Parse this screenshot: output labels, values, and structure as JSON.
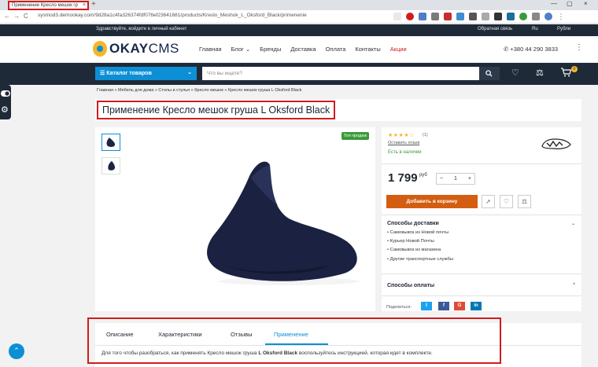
{
  "browser": {
    "tab_title": "Применение Кресло мешок гр",
    "tab_close": "×",
    "new_tab": "+",
    "window_controls": [
      "—",
      "▢",
      "×"
    ],
    "back": "←",
    "forward": "→",
    "reload": "C",
    "url": "sysmod3.demookay.com/9d28a1c4fa326374fdf076ef23641681/products/Kreslo_Meshok_L_Oksford_Black/primenenie"
  },
  "topstrip": {
    "greeting": "Здравствуйте, войдите в личный кабинет",
    "callback": "Обратная связь",
    "language": "Ru",
    "currency": "Рубли"
  },
  "header": {
    "logo_okay": "OKAY",
    "logo_cms": "CMS",
    "nav": [
      "Главная",
      "Блог",
      "Бренды",
      "Доставка",
      "Оплата",
      "Контакты"
    ],
    "nav_promo": "Акции",
    "blog_chevron": "⌄",
    "phone": "+380 44 290 3833",
    "kebab": "⋮"
  },
  "catalog": {
    "button": "Каталог товаров",
    "chevron": "⌄",
    "search_placeholder": "Что вы ищете?",
    "cart_count": "0"
  },
  "breadcrumb": "Главная » Мебель для дома » Столы и стулья » Кресло мешок » Кресло мешок груша L Oksford Black",
  "product": {
    "title": "Применение Кресло мешок груша L Oksford Black",
    "badge": "Топ продаж",
    "stars": "★★★★☆",
    "rating_count": "(1)",
    "review_link": "Оставить отзыв",
    "stock": "Есть в наличии",
    "price": "1 799",
    "currency": "руб",
    "qty_minus": "−",
    "qty_value": "1",
    "qty_plus": "+",
    "add_to_cart": "Добавить в корзину",
    "delivery_title": "Способы доставки",
    "delivery_chevron": "⌄",
    "delivery_items": [
      "Самовывоз из Новой почты",
      "Курьер Новой Почты",
      "Самовывоз из магазина",
      "Другие транспортные службы"
    ],
    "payment_title": "Способы оплаты",
    "payment_chevron": "^",
    "share_label": "Поделиться:",
    "share_buttons": [
      "t",
      "f",
      "G",
      "in"
    ]
  },
  "tabs": {
    "items": [
      "Описание",
      "Характеристики",
      "Отзывы",
      "Применение"
    ],
    "description_prefix": "Для того чтобы разобраться, как применять Кресло мешок груша ",
    "description_bold": "L Oksford Black",
    "description_suffix": " воспользуйтесь инструкцией, которая идет в комплекте."
  },
  "colors": {
    "accent_blue": "#0d8fd6",
    "dark_navy": "#1f2a38",
    "orange_cart": "#d35d10",
    "highlight_red": "#d01c1c",
    "stock_green": "#3a9a3a",
    "star_yellow": "#f5b52b"
  },
  "icons": [
    "search-icon",
    "heart-icon",
    "scales-icon",
    "cart-icon",
    "toggle-icon",
    "gear-icon",
    "arrow-up-icon",
    "rocket-icon"
  ]
}
